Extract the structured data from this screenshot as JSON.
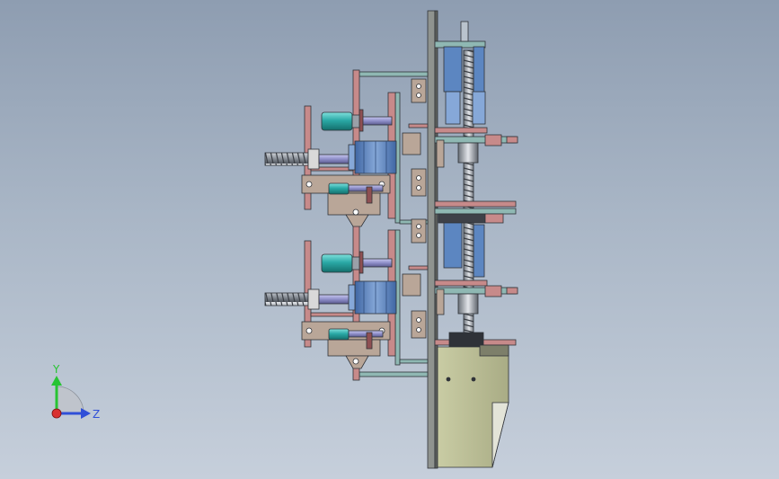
{
  "viewport": {
    "background": "gradient-blue-gray"
  },
  "model": {
    "palette": {
      "plate": "#9a9d9a",
      "plate_edge": "#3e4148",
      "bracket_red": "#c78a8a",
      "bracket_red_dark": "#8e4f52",
      "frame_teal": "#8fb8b3",
      "motor_blue": "#5c86c1",
      "motor_blue_light": "#86a8d8",
      "cylinder_teal": "#2aa9a6",
      "shaft_purple": "#8f8fc9",
      "tan_block": "#b9a698",
      "housing_olive": "#bcbf97",
      "screw_silver": "#cfd3d8",
      "screw_dark": "#5e636b"
    }
  },
  "triad": {
    "y_label": "Y",
    "z_label": "Z",
    "y_color": "#27c433",
    "z_color": "#2f4fd8",
    "origin_color": "#d93030"
  }
}
